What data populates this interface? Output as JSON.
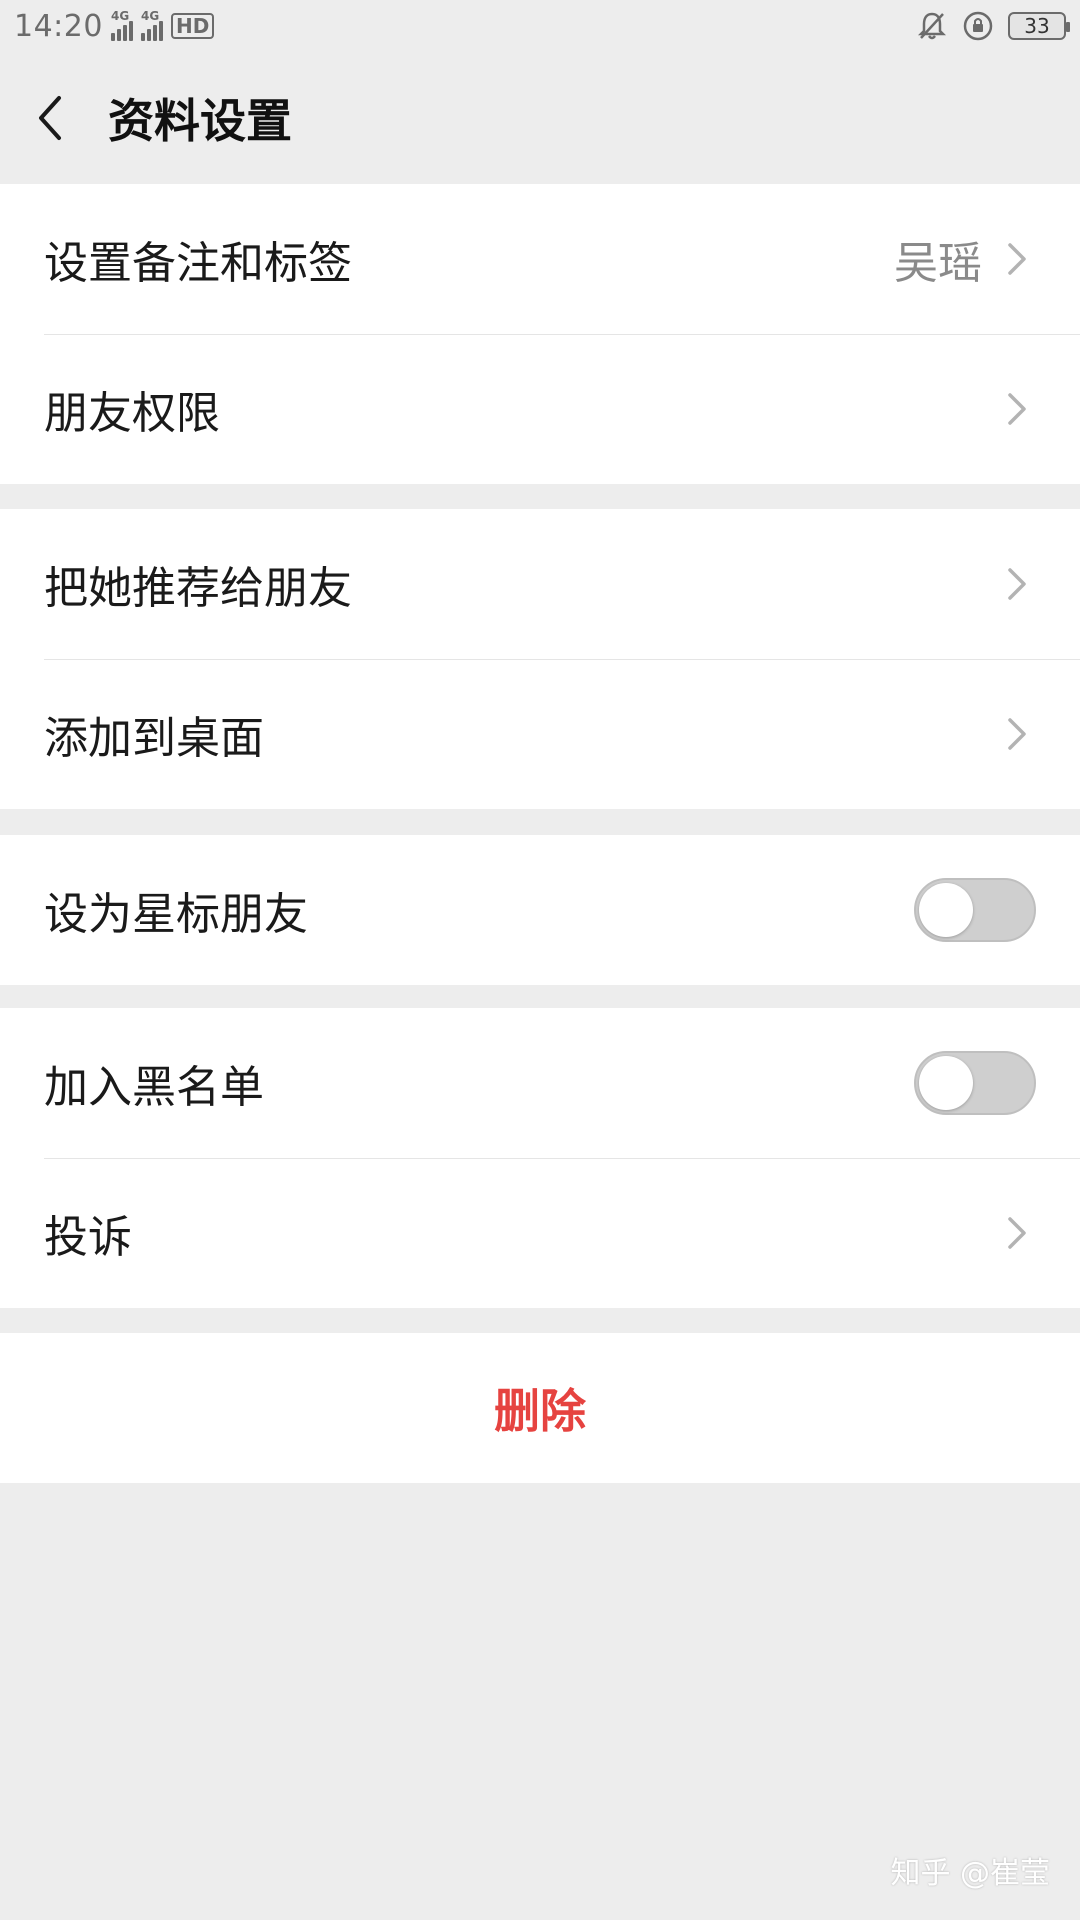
{
  "status_bar": {
    "time": "14:20",
    "network1": "4G",
    "network2": "4G",
    "hd_label": "HD",
    "battery": "33"
  },
  "nav": {
    "title": "资料设置"
  },
  "groups": {
    "g1": {
      "remark_label": "设置备注和标签",
      "remark_value": "吴瑶",
      "permission_label": "朋友权限"
    },
    "g2": {
      "recommend_label": "把她推荐给朋友",
      "desktop_label": "添加到桌面"
    },
    "g3": {
      "star_label": "设为星标朋友",
      "star_on": false
    },
    "g4": {
      "blacklist_label": "加入黑名单",
      "blacklist_on": false,
      "report_label": "投诉"
    },
    "g5": {
      "delete_label": "删除"
    }
  },
  "colors": {
    "background": "#ededed",
    "card": "#ffffff",
    "danger": "#e64340",
    "secondary_text": "#8a8a8a"
  },
  "watermark": "知乎 @崔莹"
}
